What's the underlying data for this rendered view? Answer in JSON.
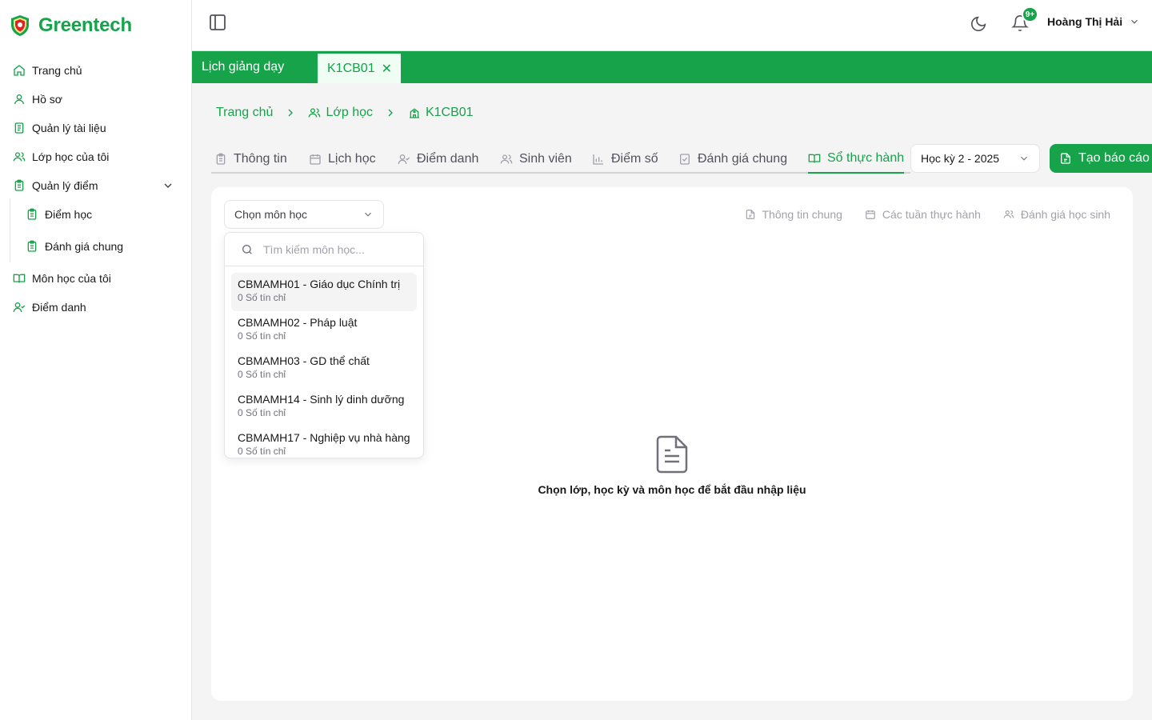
{
  "brand": {
    "name": "Greentech"
  },
  "sidebar": {
    "items": [
      {
        "label": "Trang chủ",
        "icon": "home-icon"
      },
      {
        "label": "Hồ sơ",
        "icon": "user-icon"
      },
      {
        "label": "Quản lý tài liệu",
        "icon": "document-icon"
      },
      {
        "label": "Lớp học của tôi",
        "icon": "users-icon"
      },
      {
        "label": "Quản lý điểm",
        "icon": "clipboard-icon"
      },
      {
        "label": "Điểm học",
        "icon": "clipboard-icon"
      },
      {
        "label": "Đánh giá chung",
        "icon": "clipboard-icon"
      },
      {
        "label": "Môn học của tôi",
        "icon": "book-open-icon"
      },
      {
        "label": "Điểm danh",
        "icon": "user-check-icon"
      }
    ]
  },
  "header": {
    "notification_badge": "9+",
    "user_name": "Hoàng Thị Hải"
  },
  "tabbar": {
    "main_label": "Lịch giảng dạy",
    "open_tab_label": "K1CB01",
    "close_glyph": "✕"
  },
  "breadcrumb": {
    "items": [
      "Trang chủ",
      "Lớp học",
      "K1CB01"
    ]
  },
  "page_tabs": {
    "items": [
      "Thông tin",
      "Lịch học",
      "Điểm danh",
      "Sinh viên",
      "Điểm số",
      "Đánh giá chung",
      "Sổ thực hành"
    ],
    "active": "Sổ thực hành"
  },
  "semester_select": {
    "value": "Học kỳ 2 - 2025"
  },
  "report_button": {
    "label": "Tạo báo cáo"
  },
  "subject_select": {
    "value": "Chọn môn học"
  },
  "sub_tabs": [
    "Thông tin chung",
    "Các tuần thực hành",
    "Đánh giá học sinh"
  ],
  "empty_state": {
    "text": "Chọn lớp, học kỳ và môn học để bắt đầu nhập liệu"
  },
  "dropdown": {
    "search_placeholder": "Tìm kiếm môn học...",
    "options": [
      {
        "name": "CBMAMH01 - Giáo dục Chính trị",
        "credits": "0 Số tín chỉ"
      },
      {
        "name": "CBMAMH02 - Pháp luật",
        "credits": "0 Số tín chỉ"
      },
      {
        "name": "CBMAMH03 - GD thể chất",
        "credits": "0 Số tín chỉ"
      },
      {
        "name": "CBMAMH14 - Sinh lý dinh dưỡng",
        "credits": "0 Số tín chỉ"
      },
      {
        "name": "CBMAMH17 - Nghiệp vụ nhà hàng",
        "credits": "0 Số tín chỉ"
      }
    ]
  },
  "colors": {
    "accent": "#16a34a",
    "background": "#f4f4f5"
  }
}
